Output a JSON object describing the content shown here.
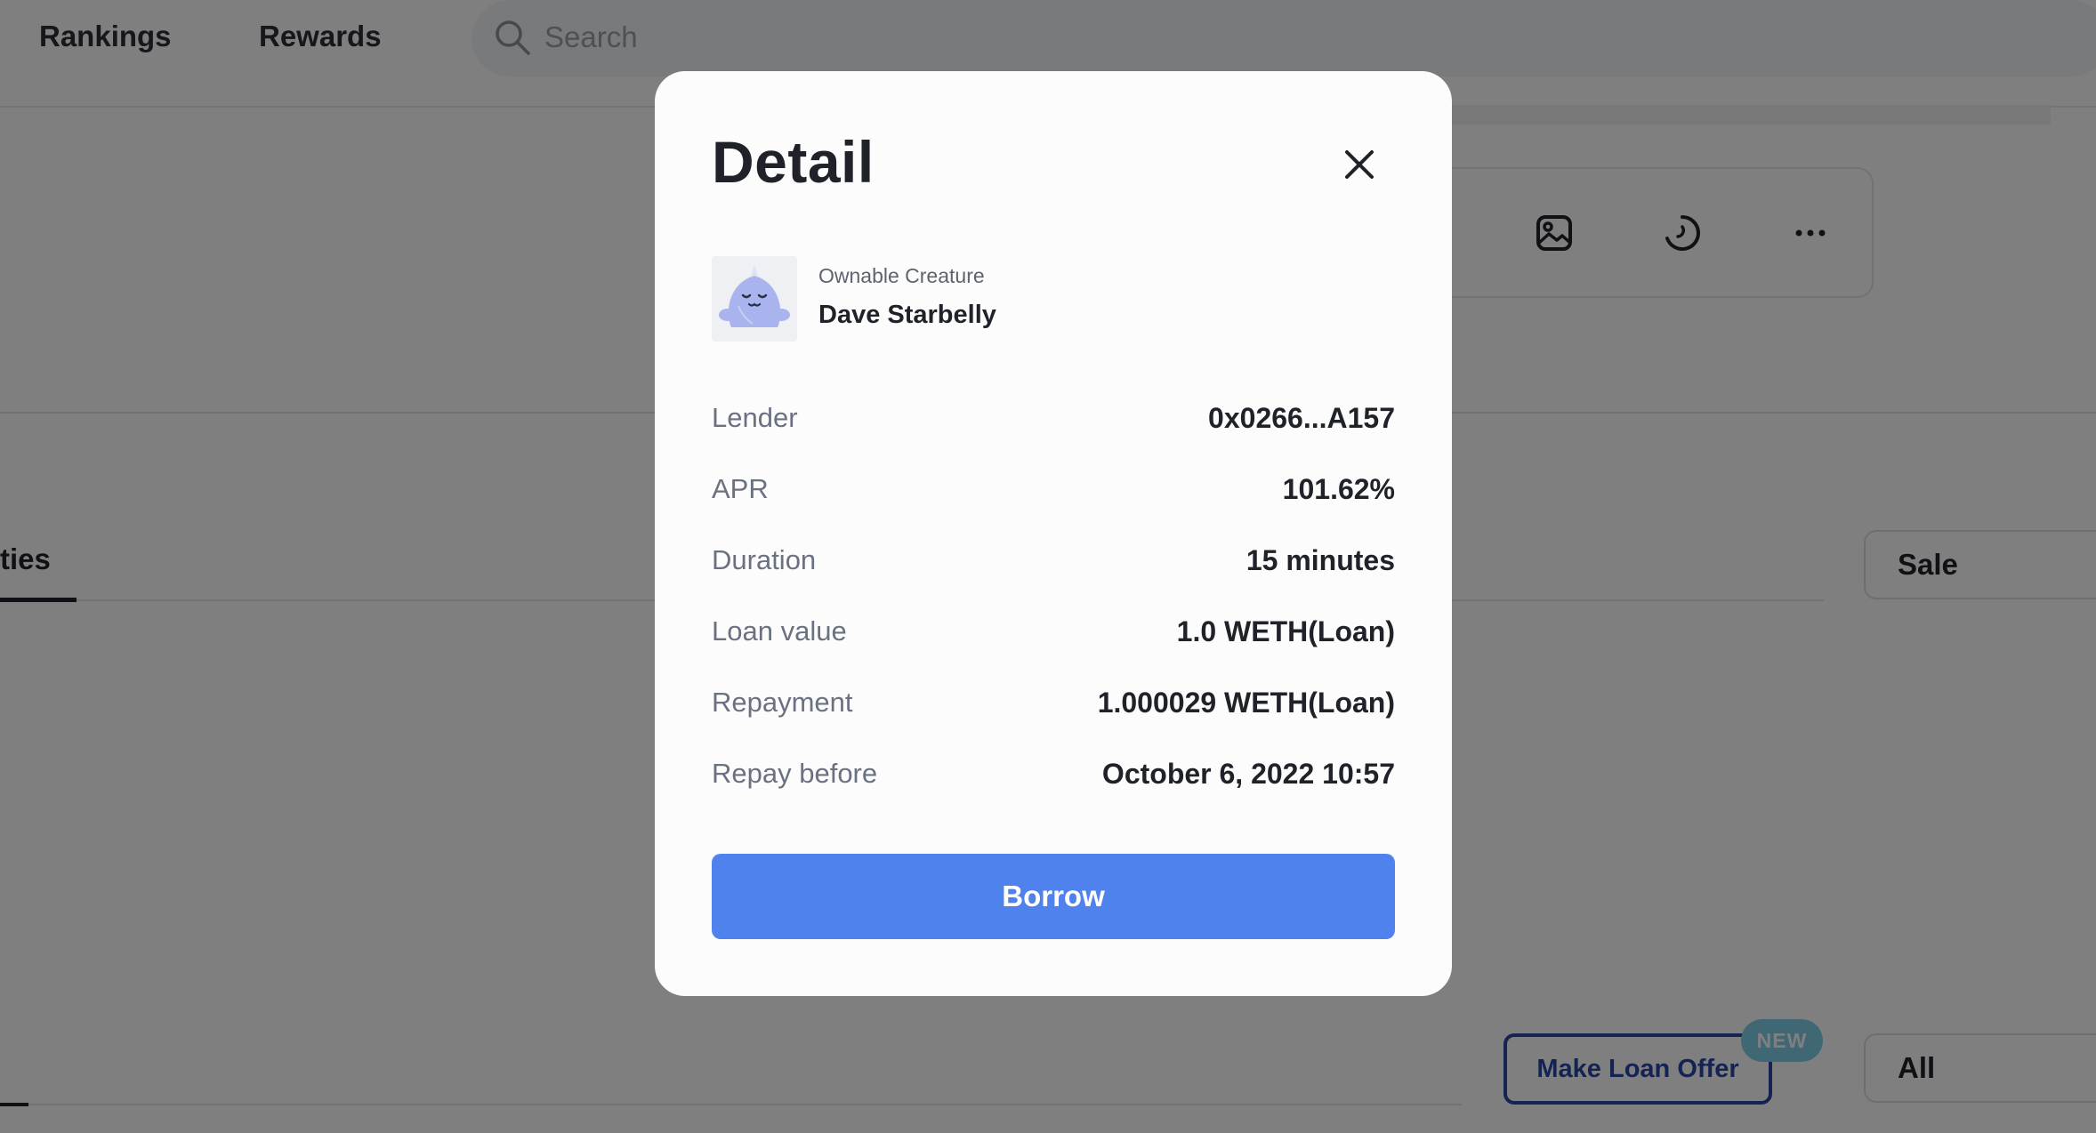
{
  "nav": {
    "items": [
      {
        "label": "Rankings"
      },
      {
        "label": "Rewards"
      }
    ]
  },
  "search": {
    "placeholder": "Search"
  },
  "tabs": {
    "active_label": "ties"
  },
  "filters": {
    "sale_select": "Sale",
    "all_select": "All"
  },
  "loan_offer": {
    "button_label": "Make Loan Offer",
    "badge": "NEW"
  },
  "modal": {
    "title": "Detail",
    "collection": "Ownable Creature",
    "item_name": "Dave Starbelly",
    "rows": [
      {
        "label": "Lender",
        "value": "0x0266...A157"
      },
      {
        "label": "APR",
        "value": "101.62%"
      },
      {
        "label": "Duration",
        "value": "15 minutes"
      },
      {
        "label": "Loan value",
        "value": "1.0 WETH(Loan)"
      },
      {
        "label": "Repayment",
        "value": "1.000029 WETH(Loan)"
      },
      {
        "label": "Repay before",
        "value": "October 6, 2022 10:57"
      }
    ],
    "primary_button": "Borrow"
  },
  "colors": {
    "primary": "#5082ee",
    "overlay": "rgba(0,0,0,0.5)",
    "badge": "#7fd0e8",
    "loan_offer_border": "#2b46a7"
  }
}
